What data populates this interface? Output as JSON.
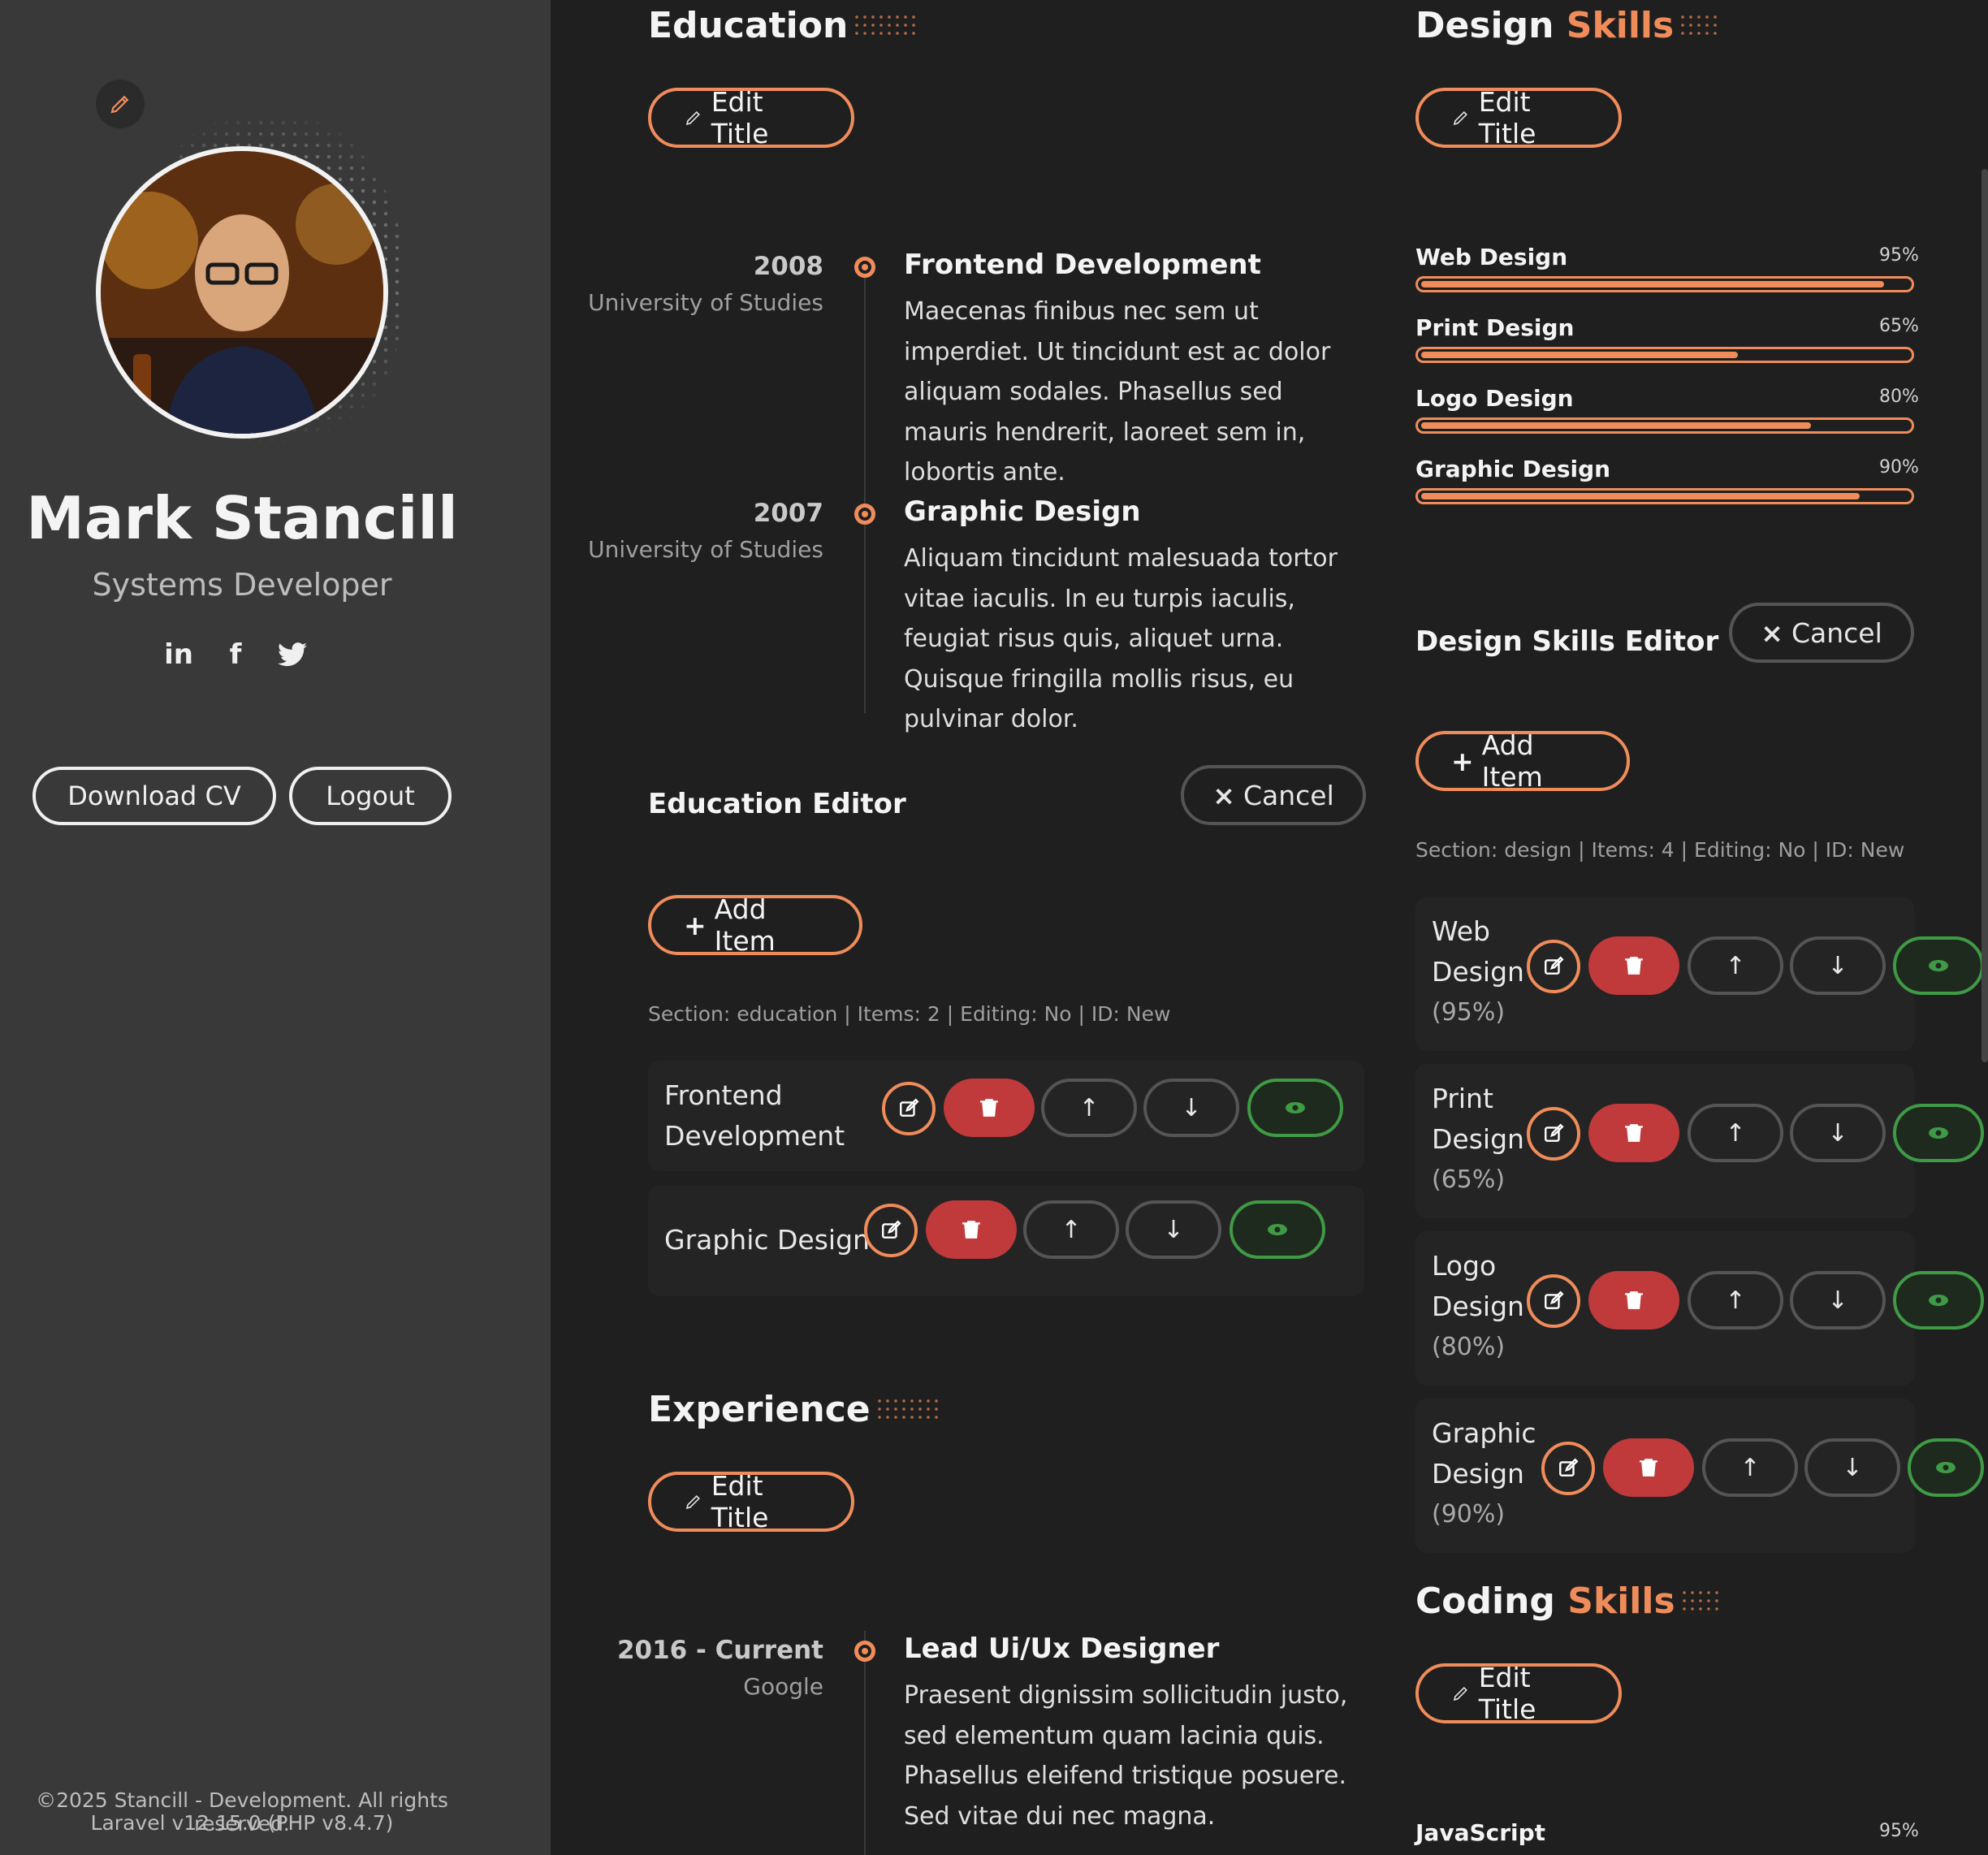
{
  "profile": {
    "name": "Mark Stancill",
    "role": "Systems Developer",
    "socials": [
      "linkedin-icon",
      "facebook-icon",
      "twitter-icon"
    ],
    "download_label": "Download CV",
    "logout_label": "Logout",
    "footer_copyright": "©2025 Stancill - Development. All rights reserved.",
    "footer_version": "Laravel v12.15.0 (PHP v8.4.7)"
  },
  "colors": {
    "accent": "#f08c5a",
    "sidebar_bg": "#393939",
    "main_bg": "#1f1f1f",
    "danger": "#c0393b",
    "success": "#3f9a45"
  },
  "education": {
    "title": "Education",
    "edit_title_label": "Edit Title",
    "entries": [
      {
        "year": "2008",
        "place": "University of Studies",
        "title": "Frontend Development",
        "desc": "Maecenas finibus nec sem ut imperdiet. Ut tincidunt est ac dolor aliquam sodales. Phasellus sed mauris hendrerit, laoreet sem in, lobortis ante."
      },
      {
        "year": "2007",
        "place": "University of Studies",
        "title": "Graphic Design",
        "desc": "Aliquam tincidunt malesuada tortor vitae iaculis. In eu turpis iaculis, feugiat risus quis, aliquet urna. Quisque fringilla mollis risus, eu pulvinar dolor."
      }
    ],
    "editor": {
      "title": "Education Editor",
      "cancel_label": "Cancel",
      "add_label": "Add Item",
      "meta": "Section: education | Items: 2 | Editing: No | ID: New",
      "items": [
        "Frontend Development",
        "Graphic Design"
      ]
    }
  },
  "experience": {
    "title": "Experience",
    "edit_title_label": "Edit Title",
    "entries": [
      {
        "year": "2016 - Current",
        "place": "Google",
        "title": "Lead Ui/Ux Designer",
        "desc": "Praesent dignissim sollicitudin justo, sed elementum quam lacinia quis. Phasellus eleifend tristique posuere. Sed vitae dui nec magna."
      }
    ]
  },
  "design_skills": {
    "title_main": "Design",
    "title_accent": "Skills",
    "edit_title_label": "Edit Title",
    "skills": [
      {
        "name": "Web Design",
        "pct_label": "95%",
        "value": 0.95
      },
      {
        "name": "Print Design",
        "pct_label": "65%",
        "value": 0.65
      },
      {
        "name": "Logo Design",
        "pct_label": "80%",
        "value": 0.8
      },
      {
        "name": "Graphic Design",
        "pct_label": "90%",
        "value": 0.9
      }
    ],
    "editor": {
      "title": "Design Skills Editor",
      "cancel_label": "Cancel",
      "add_label": "Add Item",
      "meta": "Section: design | Items: 4 | Editing: No | ID: New",
      "items": [
        {
          "l1": "Web",
          "l2": "Design",
          "pct": "(95%)"
        },
        {
          "l1": "Print",
          "l2": "Design",
          "pct": "(65%)"
        },
        {
          "l1": "Logo",
          "l2": "Design",
          "pct": "(80%)"
        },
        {
          "l1": "Graphic",
          "l2": "Design",
          "pct": "(90%)"
        }
      ]
    }
  },
  "coding_skills": {
    "title_main": "Coding",
    "title_accent": "Skills",
    "edit_title_label": "Edit Title",
    "skills": [
      {
        "name": "JavaScript",
        "pct_label": "95%",
        "value": 0.95
      }
    ]
  }
}
